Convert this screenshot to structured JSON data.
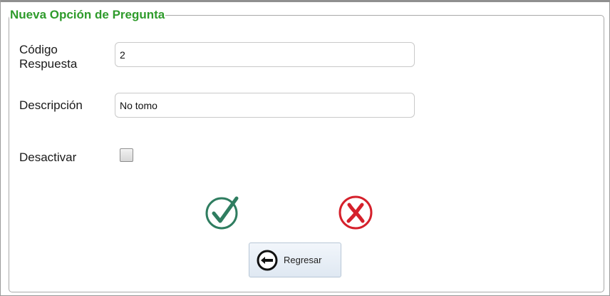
{
  "form": {
    "legend": "Nueva Opción de Pregunta",
    "codigo_label_line1": "Código",
    "codigo_label_line2": "Respuesta",
    "codigo_value": "2",
    "descripcion_label": "Descripción",
    "descripcion_value": "No tomo",
    "desactivar_label": "Desactivar",
    "desactivar_checked": false
  },
  "actions": {
    "confirm_icon": "check-circle-icon",
    "cancel_icon": "x-circle-icon",
    "back_icon": "arrow-left-circle-icon",
    "back_label": "Regresar"
  },
  "colors": {
    "legend": "#2e9b2b",
    "confirm": "#2f7d60",
    "cancel": "#d5202b"
  }
}
